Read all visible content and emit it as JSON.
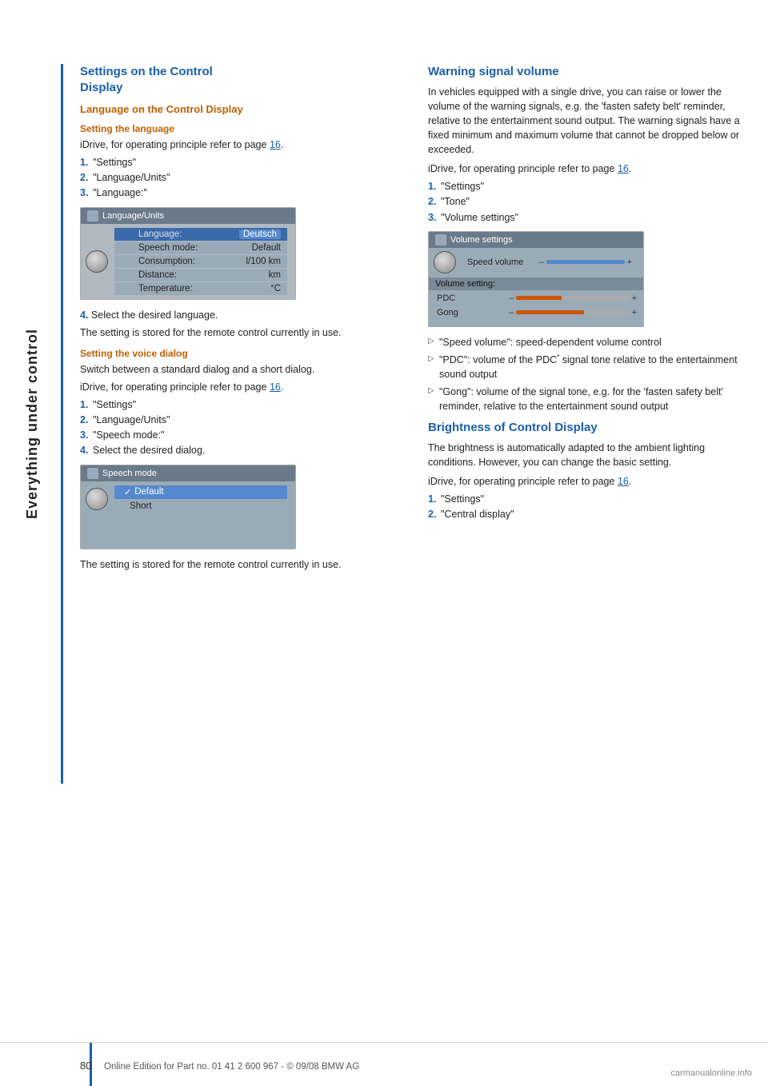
{
  "sidebar": {
    "text": "Everything under control"
  },
  "left_col": {
    "section_title_line1": "Settings on the Control",
    "section_title_line2": "Display",
    "sub1_title": "Language on the Control Display",
    "sub1a_title": "Setting the language",
    "sub1a_intro": "iDrive, for operating principle refer to page",
    "sub1a_page": "16",
    "sub1a_items": [
      {
        "num": "1.",
        "text": "\"Settings\""
      },
      {
        "num": "2.",
        "text": "\"Language/Units\""
      },
      {
        "num": "3.",
        "text": "\"Language:\""
      }
    ],
    "sub1a_step4": "4.",
    "sub1a_step4_text": "Select the desired language.",
    "sub1a_note": "The setting is stored for the remote control currently in use.",
    "sub1b_title": "Setting the voice dialog",
    "sub1b_intro": "Switch between a standard dialog and a short dialog.",
    "sub1b_intro2": "iDrive, for operating principle refer to page",
    "sub1b_page": "16",
    "sub1b_items": [
      {
        "num": "1.",
        "text": "\"Settings\""
      },
      {
        "num": "2.",
        "text": "\"Language/Units\""
      },
      {
        "num": "3.",
        "text": "\"Speech mode:\""
      },
      {
        "num": "4.",
        "text": "Select the desired dialog."
      }
    ],
    "sub1b_note": "The setting is stored for the remote control currently in use."
  },
  "right_col": {
    "warn_title": "Warning signal volume",
    "warn_text": "In vehicles equipped with a single drive, you can raise or lower the volume of the warning signals, e.g. the 'fasten safety belt' reminder, relative to the entertainment sound output. The warning signals have a fixed minimum and maximum volume that cannot be dropped below or exceeded.",
    "warn_intro": "iDrive, for operating principle refer to page",
    "warn_page": "16",
    "warn_items": [
      {
        "num": "1.",
        "text": "\"Settings\""
      },
      {
        "num": "2.",
        "text": "\"Tone\""
      },
      {
        "num": "3.",
        "text": "\"Volume settings\""
      }
    ],
    "warn_bullets": [
      "\"Speed volume\": speed-dependent volume control",
      "\"PDC\": volume of the PDC* signal tone relative to the entertainment sound output",
      "\"Gong\": volume of the signal tone, e.g. for the 'fasten safety belt' reminder, relative to the entertainment sound output"
    ],
    "brightness_title": "Brightness of Control Display",
    "brightness_text": "The brightness is automatically adapted to the ambient lighting conditions. However, you can change the basic setting.",
    "brightness_intro": "iDrive, for operating principle refer to page",
    "brightness_page": "16",
    "brightness_items": [
      {
        "num": "1.",
        "text": "\"Settings\""
      },
      {
        "num": "2.",
        "text": "\"Central display\""
      }
    ]
  },
  "screen_lang": {
    "title": "Language/Units",
    "rows": [
      {
        "label": "Language:",
        "value": "Deutsch",
        "highlight": true
      },
      {
        "label": "Speech mode:",
        "value": "Default",
        "highlight": false
      },
      {
        "label": "Consumption:",
        "value": "l/100 km",
        "highlight": false
      },
      {
        "label": "Distance:",
        "value": "km",
        "highlight": false
      },
      {
        "label": "Temperature:",
        "value": "°C",
        "highlight": false
      }
    ]
  },
  "screen_speech": {
    "title": "Speech mode",
    "rows": [
      {
        "label": "Default",
        "selected": true,
        "check": true
      },
      {
        "label": "Short",
        "selected": false,
        "check": false
      }
    ]
  },
  "screen_volume": {
    "title": "Volume settings",
    "speed_label": "Speed volume",
    "section_label": "Volume setting:",
    "rows": [
      {
        "label": "PDC",
        "value": ""
      },
      {
        "label": "Gong",
        "value": ""
      }
    ]
  },
  "footer": {
    "page_num": "80",
    "footer_text": "Online Edition for Part no. 01 41 2 600 967  - © 09/08 BMW AG"
  }
}
